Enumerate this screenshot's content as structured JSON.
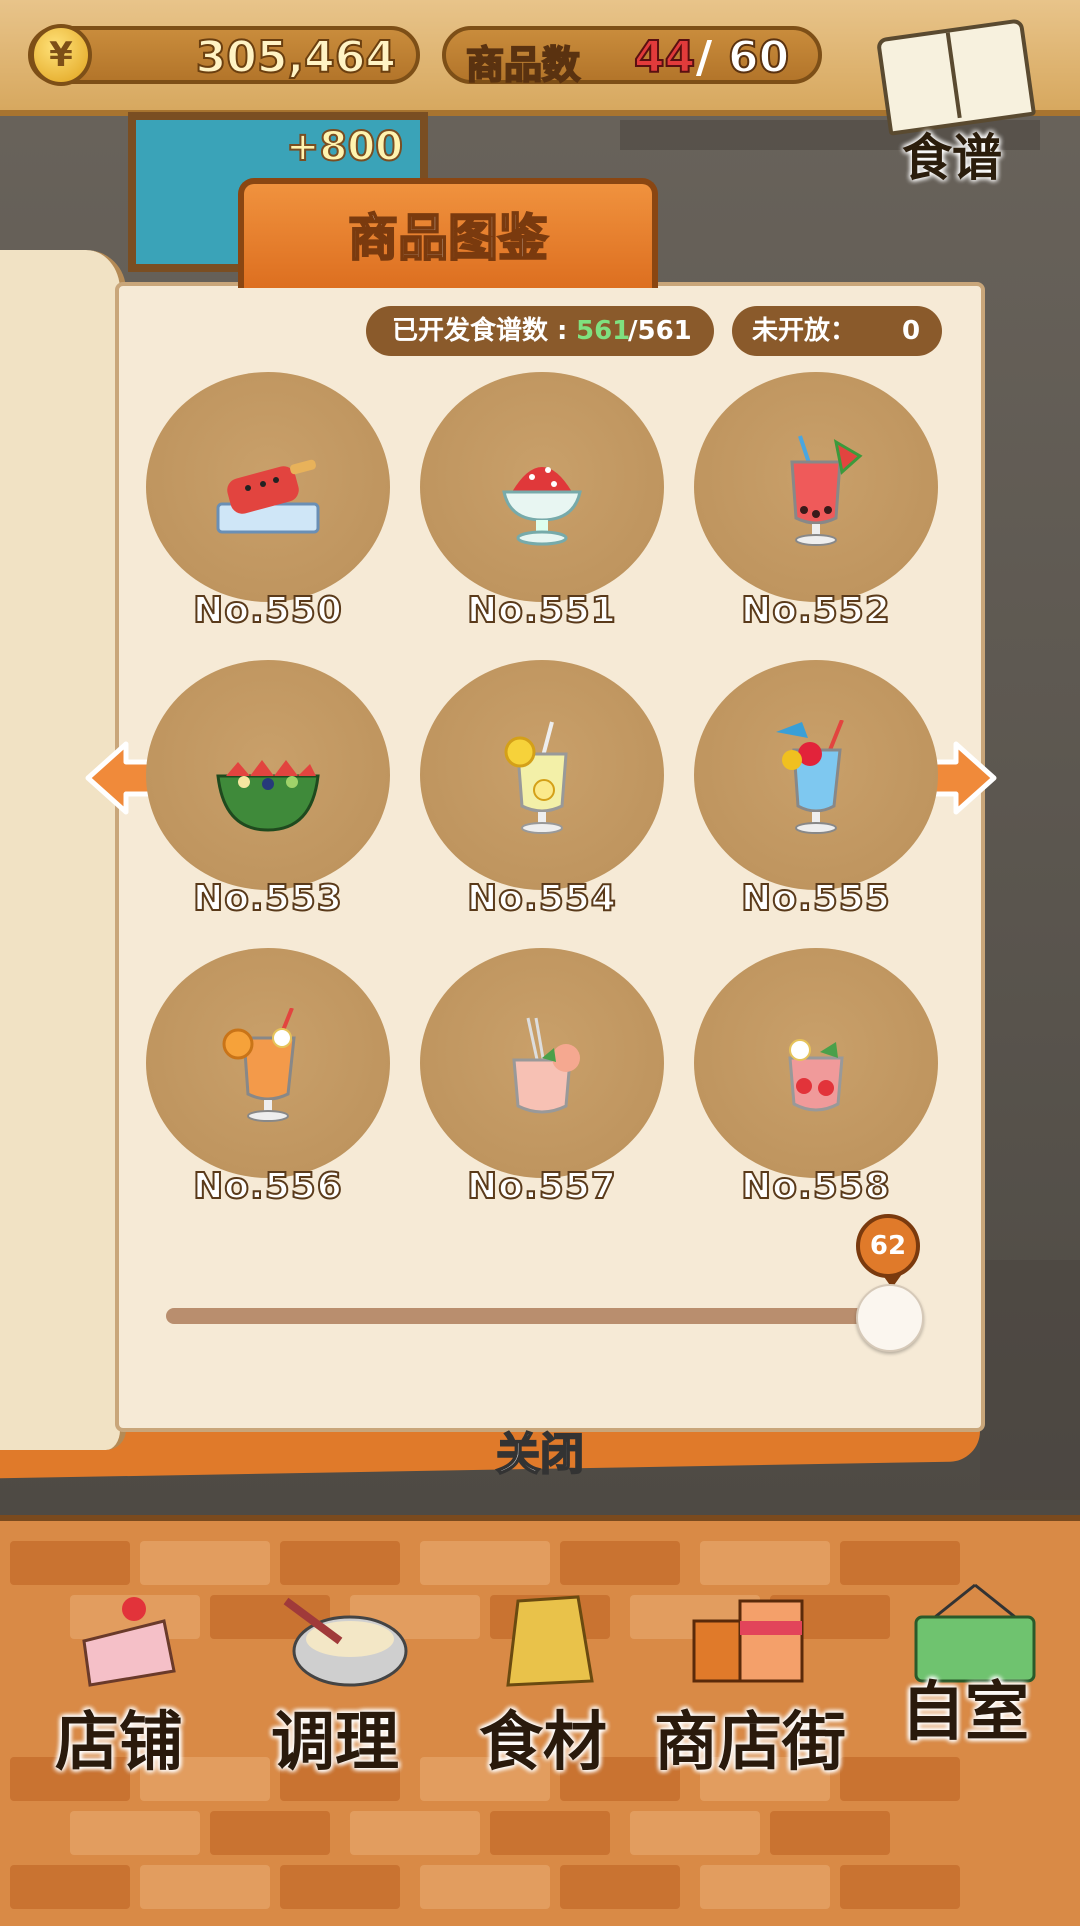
{
  "hud": {
    "money": "305,464",
    "items_label": "商品数",
    "items_current": "44",
    "items_separator": "/",
    "items_max": "60",
    "recipe_label": "食谱",
    "poster_bonus": "+800"
  },
  "book": {
    "title": "商品图鉴",
    "developed_label": "已开发食谱数 :",
    "developed_count": "561",
    "developed_total": "/561",
    "unopened_label": "未开放：",
    "unopened_count": "0",
    "items": [
      {
        "label": "No.550",
        "icon": "watermelon-popsicle"
      },
      {
        "label": "No.551",
        "icon": "watermelon-shaved-ice"
      },
      {
        "label": "No.552",
        "icon": "watermelon-bubble-tea"
      },
      {
        "label": "No.553",
        "icon": "watermelon-fruit-bowl"
      },
      {
        "label": "No.554",
        "icon": "lemon-soda"
      },
      {
        "label": "No.555",
        "icon": "blue-hawaii-drink"
      },
      {
        "label": "No.556",
        "icon": "tropical-orange-drink"
      },
      {
        "label": "No.557",
        "icon": "peach-drink"
      },
      {
        "label": "No.558",
        "icon": "strawberry-drink"
      }
    ],
    "slider_value": "62",
    "close_label": "关闭"
  },
  "nav": [
    {
      "label": "店铺",
      "icon": "cake-icon"
    },
    {
      "label": "调理",
      "icon": "whisk-bowl-icon"
    },
    {
      "label": "食材",
      "icon": "flour-bag-icon"
    },
    {
      "label": "商店街",
      "icon": "shop-building-icon"
    },
    {
      "label": "自室",
      "icon": "staff-only-sign-icon"
    }
  ],
  "colors": {
    "accent_orange": "#e07a2a",
    "page_bg": "#f6ead6",
    "circle_bg": "#c9a06a",
    "count_red": "#e23b3b",
    "count_green": "#7fe07f"
  }
}
